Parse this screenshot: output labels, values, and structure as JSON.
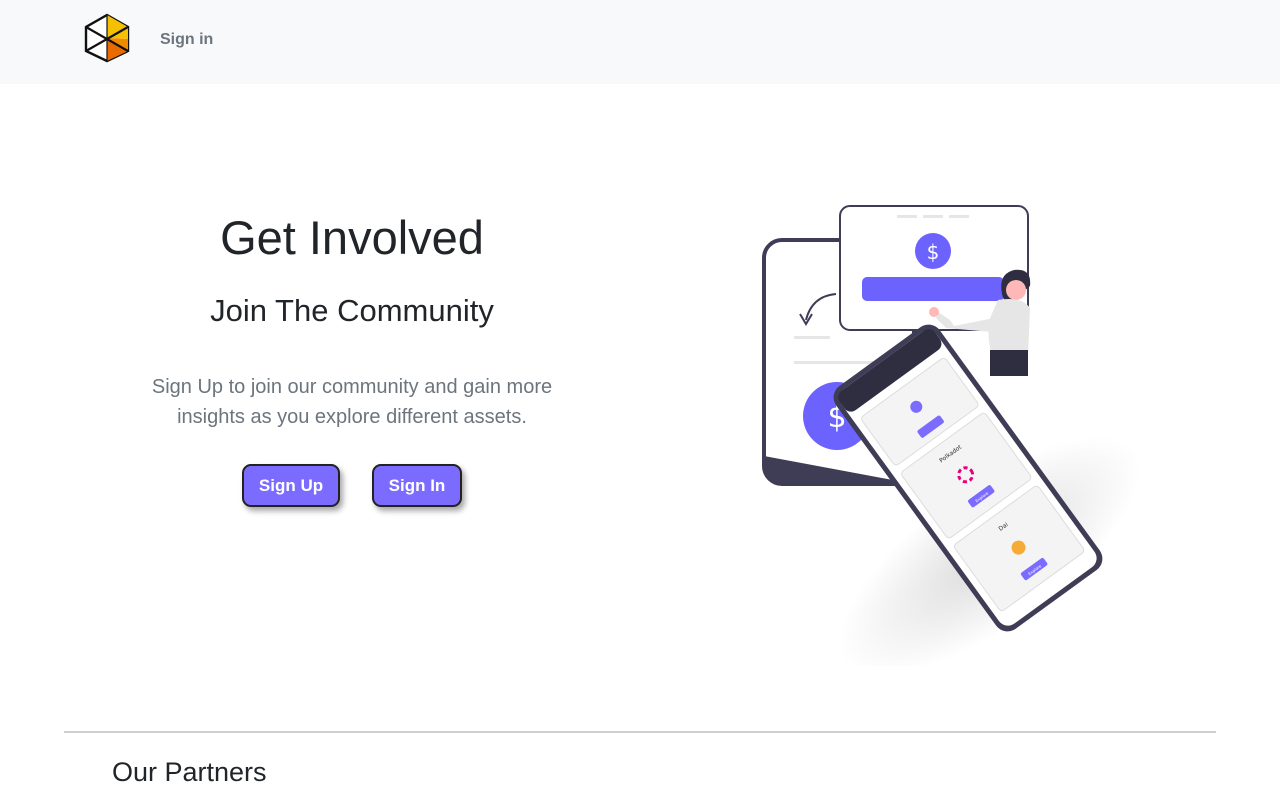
{
  "nav": {
    "logo_name": "hexagon-logo",
    "signin_label": "Sign in"
  },
  "hero": {
    "title": "Get Involved",
    "subtitle": "Join The Community",
    "text": "Sign Up to join our community and gain more insights as you explore different assets.",
    "signup_label": "Sign Up",
    "signin_label": "Sign In"
  },
  "illustration": {
    "coin_symbol": "$",
    "phone_cards": [
      {
        "name": "Polkadot",
        "button": "Explore"
      },
      {
        "name": "Dai",
        "button": "Explore"
      }
    ]
  },
  "partners": {
    "title": "Our Partners"
  },
  "colors": {
    "accent": "#7b6cff",
    "navbar_bg": "#f8f9fa",
    "muted_text": "#6c757d"
  }
}
